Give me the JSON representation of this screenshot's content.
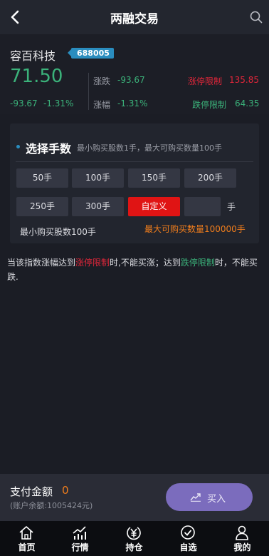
{
  "header": {
    "title": "两融交易"
  },
  "stock": {
    "name": "容百科技",
    "code": "688005",
    "price": "71.50",
    "change": "-93.67",
    "change_pct": "-1.31%",
    "label_change": "涨跌",
    "value_change": "-93.67",
    "label_pct": "涨幅",
    "value_pct": "-1.31%",
    "limit_up_label": "涨停限制",
    "limit_up_value": "135.85",
    "limit_down_label": "跌停限制",
    "limit_down_value": "64.35"
  },
  "quantity": {
    "title": "选择手数",
    "note": "最小购买股数1手，最大可购买数量100手",
    "options": [
      "50手",
      "100手",
      "150手",
      "200手",
      "250手",
      "300手",
      "自定义"
    ],
    "custom_value": "",
    "unit": "手",
    "min_text": "最小购买股数100手",
    "max_text": "最大可购买数量100000手"
  },
  "notice": {
    "part1": "当该指数涨幅达到",
    "limit_up": "涨停限制",
    "part2": "时,不能买涨；达到",
    "limit_down": "跌停限制",
    "part3": "时，不能买跌."
  },
  "payment": {
    "label": "支付金额",
    "amount": "0",
    "balance": "(账户余额:1005424元)",
    "buy_label": "买入"
  },
  "tabs": [
    "首页",
    "行情",
    "持仓",
    "自选",
    "我的"
  ],
  "colors": {
    "background": "#1b1d25",
    "green": "#3bb27a",
    "red": "#e0263a",
    "orange": "#f07d1c",
    "accent_blue": "#2a8dbf",
    "buy_button": "#7b6cbd"
  },
  "icons": [
    "back-arrow-icon",
    "search-icon",
    "chart-icon",
    "home-icon",
    "market-icon",
    "yuan-icon",
    "check-circle-icon",
    "user-icon"
  ]
}
